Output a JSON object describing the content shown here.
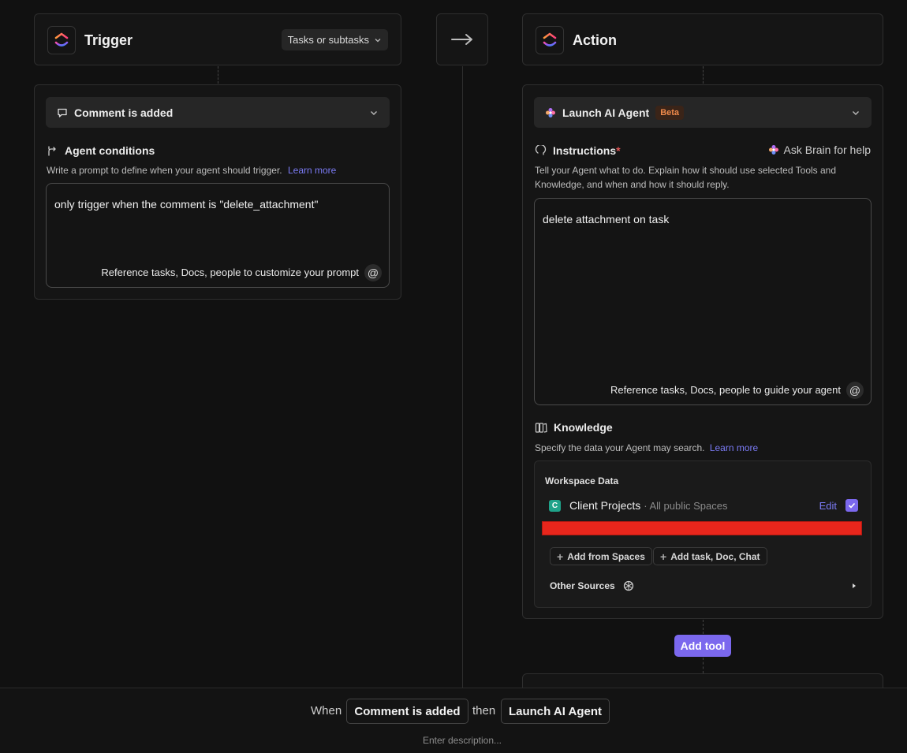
{
  "trigger": {
    "title": "Trigger",
    "scope_select": "Tasks or subtasks",
    "event_dropdown": "Comment is added",
    "conditions": {
      "title": "Agent conditions",
      "hint": "Write a prompt to define when your agent should trigger.",
      "learn_more": "Learn more",
      "value": "only trigger when the comment is \"delete_attachment\"",
      "reference_hint": "Reference tasks, Docs, people to customize your prompt"
    }
  },
  "action": {
    "title": "Action",
    "action_dropdown": "Launch AI Agent",
    "beta_badge": "Beta",
    "instructions": {
      "title": "Instructions",
      "required_mark": "*",
      "ask_brain": "Ask Brain for help",
      "hint": "Tell your Agent what to do. Explain how it should use selected Tools and Knowledge, and when and how it should reply.",
      "value": "delete attachment on task",
      "reference_hint": "Reference tasks, Docs, people to guide your agent"
    },
    "knowledge": {
      "title": "Knowledge",
      "hint": "Specify the data your Agent may search.",
      "learn_more": "Learn more",
      "workspace_title": "Workspace Data",
      "space_letter": "C",
      "space_name": "Client Projects",
      "space_scope": "· All public Spaces",
      "edit": "Edit",
      "add_from_spaces": "Add from Spaces",
      "add_task_doc": "Add task, Doc, Chat",
      "other_sources": "Other Sources"
    },
    "add_tool": "Add tool"
  },
  "summary": {
    "when": "When",
    "trigger_chip": "Comment is added",
    "then": "then",
    "action_chip": "Launch AI Agent",
    "description_placeholder": "Enter description..."
  },
  "colors": {
    "accent": "#7b68ee",
    "link": "#7b7bf5",
    "beta_bg": "#3a2418",
    "beta_text": "#f08a4b",
    "redaction": "#e8261c",
    "space_icon": "#1fa38a"
  },
  "icons": {
    "logo": "clickup-logo",
    "arrow": "arrow-right-icon",
    "comment": "comment-icon",
    "conditions": "branch-icon",
    "agent": "ai-flower-icon",
    "instructions": "bulb-icon",
    "brain": "ai-flower-icon",
    "knowledge": "books-icon",
    "mention": "at-icon",
    "openai": "openai-icon"
  }
}
